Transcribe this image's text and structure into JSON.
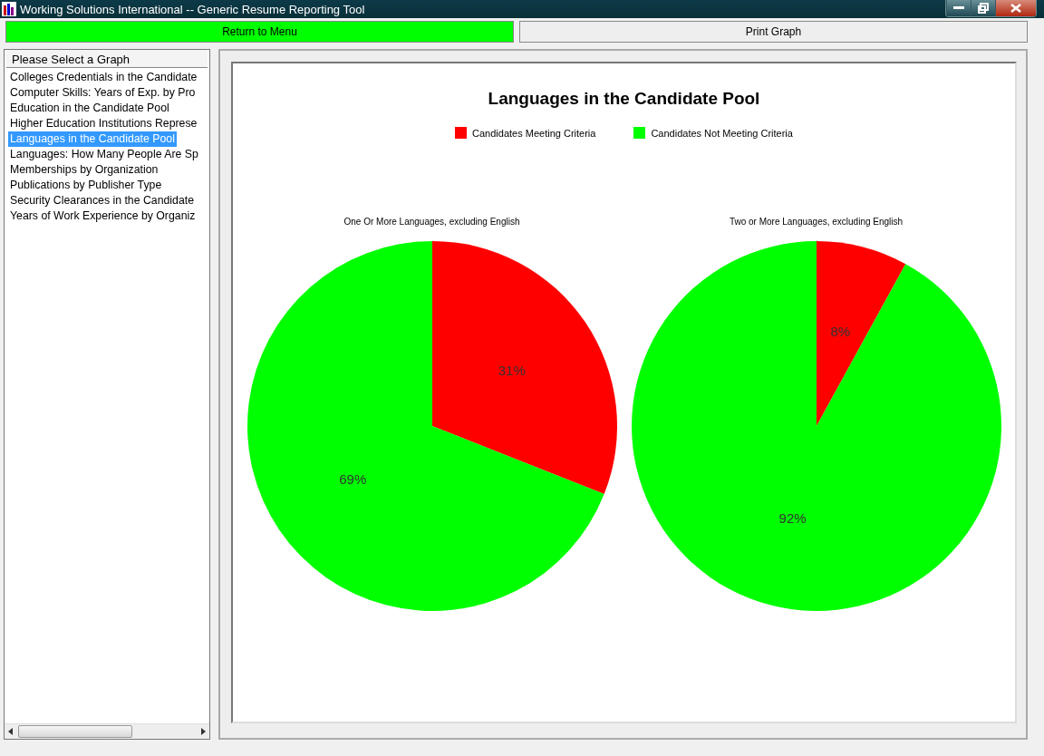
{
  "window": {
    "title": "Working Solutions International  --  Generic Resume Reporting Tool"
  },
  "toolbar": [
    {
      "label": "Return to Menu",
      "kind": "primary"
    },
    {
      "label": "Print Graph",
      "kind": "plain"
    }
  ],
  "graph_list": {
    "header": "Please Select a Graph",
    "items": [
      {
        "label": "Colleges Credentials in the Candidate",
        "selected": false
      },
      {
        "label": "Computer Skills: Years of Exp. by Pro",
        "selected": false
      },
      {
        "label": "Education in the Candidate Pool",
        "selected": false
      },
      {
        "label": "Higher Education Institutions Represe",
        "selected": false
      },
      {
        "label": "Languages in the Candidate Pool",
        "selected": true
      },
      {
        "label": "Languages: How Many People Are Sp",
        "selected": false
      },
      {
        "label": "Memberships by Organization",
        "selected": false
      },
      {
        "label": "Publications by Publisher Type",
        "selected": false
      },
      {
        "label": "Security Clearances in the Candidate",
        "selected": false
      },
      {
        "label": "Years of Work Experience by Organiz",
        "selected": false
      }
    ]
  },
  "graph": {
    "title": "Languages in the Candidate Pool",
    "legend": [
      {
        "label": "Candidates Meeting Criteria",
        "color": "#ff0000"
      },
      {
        "label": "Candidates Not Meeting Criteria",
        "color": "#00ff00"
      }
    ],
    "pies": [
      {
        "chart_data": {
          "type": "pie",
          "title": "One Or More Languages, excluding English",
          "values": [
            31,
            69
          ],
          "value_labels": [
            "31%",
            "69%"
          ]
        }
      },
      {
        "chart_data": {
          "type": "pie",
          "title": "Two or More Languages, excluding English",
          "values": [
            8,
            92
          ],
          "value_labels": [
            "8%",
            "92%"
          ]
        }
      }
    ]
  }
}
